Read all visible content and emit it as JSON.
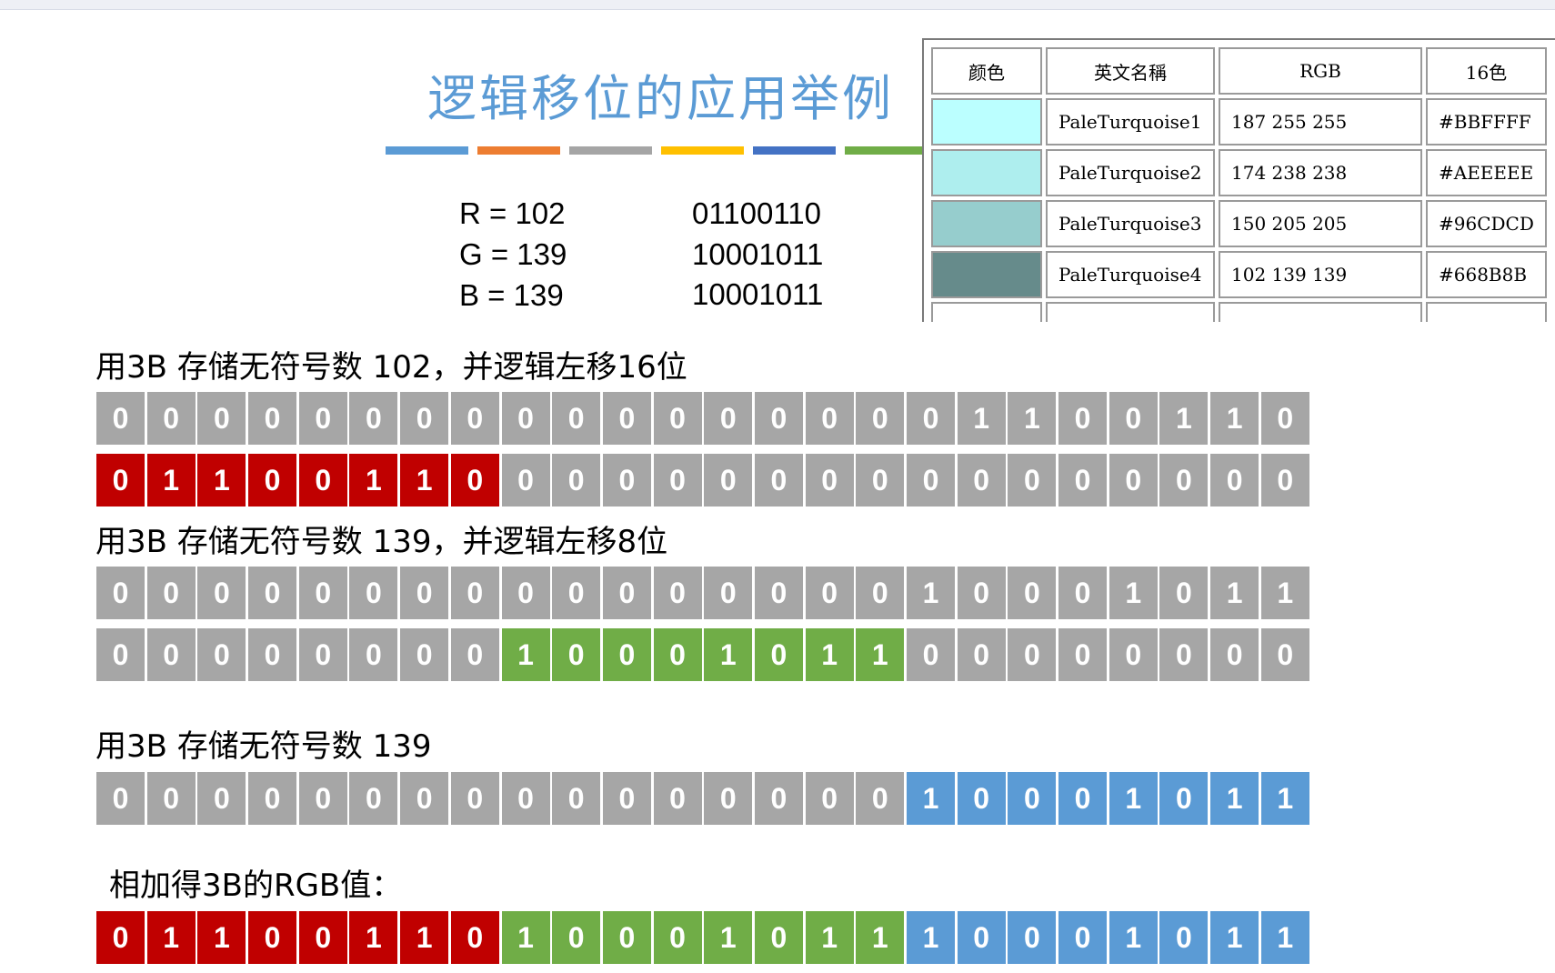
{
  "title": "逻辑移位的应用举例",
  "accent_colors": [
    "#5b9bd5",
    "#ed7d31",
    "#a5a5a5",
    "#ffc000",
    "#4472c4",
    "#70ad47"
  ],
  "rgb_values": [
    {
      "label": "R = 102",
      "binary": "01100110"
    },
    {
      "label": "G = 139",
      "binary": "10001011"
    },
    {
      "label": "B = 139",
      "binary": "10001011"
    }
  ],
  "color_table": {
    "headers": [
      "颜色",
      "英文名稱",
      "RGB",
      "16色"
    ],
    "rows": [
      {
        "swatch": "#BBFFFF",
        "name": "PaleTurquoise1",
        "rgb": "187 255 255",
        "hex": "#BBFFFF"
      },
      {
        "swatch": "#AEEEEE",
        "name": "PaleTurquoise2",
        "rgb": "174 238 238",
        "hex": "#AEEEEE"
      },
      {
        "swatch": "#96CDCD",
        "name": "PaleTurquoise3",
        "rgb": "150 205 205",
        "hex": "#96CDCD"
      },
      {
        "swatch": "#668B8B",
        "name": "PaleTurquoise4",
        "rgb": "102 139 139",
        "hex": "#668B8B"
      }
    ]
  },
  "captions": {
    "r_shift": "用3B 存储无符号数 102，并逻辑左移16位",
    "g_shift": "用3B 存储无符号数 139，并逻辑左移8位",
    "b_store": "用3B 存储无符号数 139",
    "sum": "相加得3B的RGB值："
  },
  "bit_rows": [
    {
      "id": "r-original",
      "bits": "000000000000000001100110",
      "highlight": null
    },
    {
      "id": "r-shifted",
      "bits": "011001100000000000000000",
      "highlight": {
        "color": "red",
        "start": 0,
        "end": 8
      }
    },
    {
      "id": "g-original",
      "bits": "000000000000000010001011",
      "highlight": null
    },
    {
      "id": "g-shifted",
      "bits": "000000001000101100000000",
      "highlight": {
        "color": "green",
        "start": 8,
        "end": 16
      }
    },
    {
      "id": "b-stored",
      "bits": "000000000000000010001011",
      "highlight": {
        "color": "blue",
        "start": 16,
        "end": 24
      }
    },
    {
      "id": "rgb-sum",
      "bits": "011001101000101110001011",
      "segments": [
        "red",
        "green",
        "blue"
      ]
    }
  ]
}
